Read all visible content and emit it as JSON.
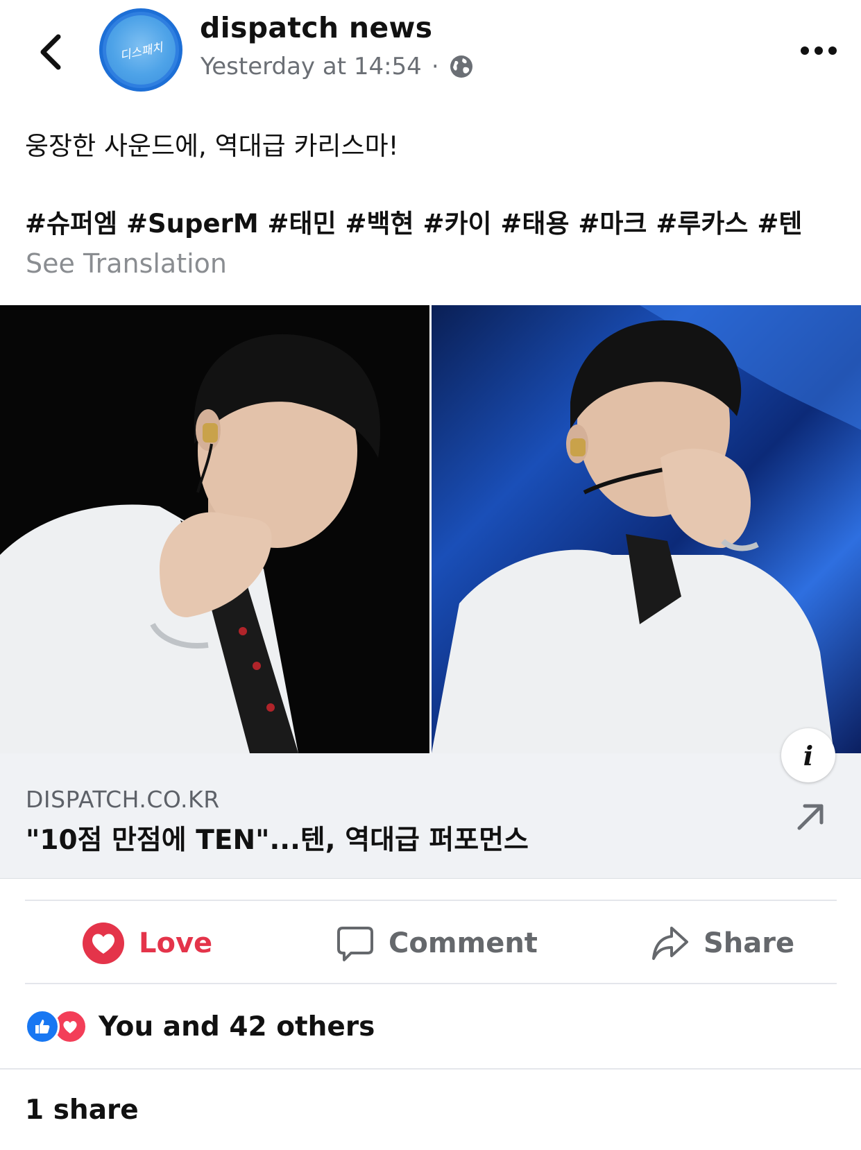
{
  "header": {
    "page_name": "dispatch news",
    "timestamp": "Yesterday at 14:54",
    "separator": "·",
    "audience_icon": "globe-icon",
    "avatar_logo_text": "디스패치"
  },
  "post": {
    "text": "웅장한 사운드에, 역대급 카리스마!",
    "hashtags": "#슈퍼엠 #SuperM #태민 #백현 #카이 #태용 #마크 #루카스 #텐",
    "see_translation": "See Translation"
  },
  "link": {
    "domain": "DISPATCH.CO.KR",
    "title": "\"10점 만점에 TEN\"...텐, 역대급 퍼포먼스"
  },
  "actions": {
    "love": "Love",
    "comment": "Comment",
    "share": "Share"
  },
  "reactions": {
    "summary": "You and 42 others"
  },
  "shares": {
    "count_text": "1 share"
  },
  "colors": {
    "love": "#e4344a",
    "like_badge": "#1877f2",
    "heart_badge": "#f33e58",
    "muted": "#65686c",
    "avatar_border": "#1d6fd6"
  }
}
